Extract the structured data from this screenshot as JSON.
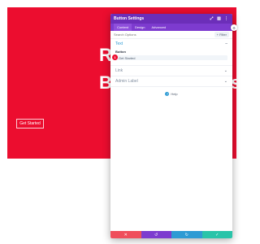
{
  "hero": {
    "line1": "R",
    "line1b": "",
    "line2": "B",
    "line2b": "si",
    "button_label": "Get Started",
    "background": "#ec0d2f"
  },
  "modal": {
    "title": "Button Settings",
    "header_icons": [
      "expand-icon",
      "columns-icon",
      "more-icon"
    ],
    "tabs": [
      "Content",
      "Design",
      "Advanced"
    ],
    "search": {
      "placeholder": "Search Options",
      "filter_label": "+ Filter"
    },
    "sections": {
      "text": {
        "title": "Text",
        "field_label": "Button",
        "field_value": "Get Started",
        "badge": "1"
      },
      "link": {
        "title": "Link"
      },
      "admin": {
        "title": "Admin Label"
      }
    },
    "help": {
      "label": "Help",
      "icon": "?"
    },
    "footer": {
      "buttons": [
        {
          "icon": "✕",
          "color": "#ef4e5b"
        },
        {
          "icon": "↺",
          "color": "#7d3bcf"
        },
        {
          "icon": "↻",
          "color": "#2e9bd4"
        },
        {
          "icon": "✓",
          "color": "#29c4a9"
        }
      ]
    },
    "colors": {
      "header": "#6c2eb9",
      "tabs": "#7d3bcf",
      "accent": "#2e9bd4"
    }
  }
}
